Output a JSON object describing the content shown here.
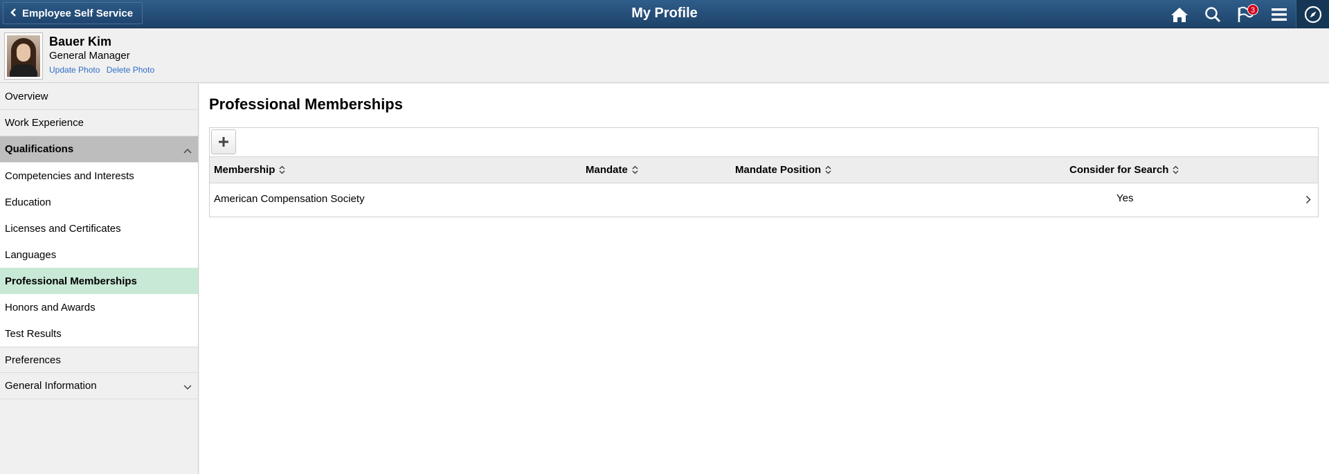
{
  "banner": {
    "back_label": "Employee Self Service",
    "title": "My Profile",
    "notification_count": "3",
    "icons": [
      "home-icon",
      "search-icon",
      "notification-flag-icon",
      "menu-icon",
      "navbar-compass-icon"
    ]
  },
  "profile": {
    "name": "Bauer Kim",
    "job_title": "General Manager",
    "update_photo": "Update Photo",
    "delete_photo": "Delete Photo"
  },
  "sidebar": {
    "items": [
      {
        "label": "Overview"
      },
      {
        "label": "Work Experience"
      },
      {
        "label": "Qualifications"
      },
      {
        "label": "Competencies and Interests"
      },
      {
        "label": "Education"
      },
      {
        "label": "Licenses and Certificates"
      },
      {
        "label": "Languages"
      },
      {
        "label": "Professional Memberships"
      },
      {
        "label": "Honors and Awards"
      },
      {
        "label": "Test Results"
      },
      {
        "label": "Preferences"
      },
      {
        "label": "General Information"
      }
    ],
    "active": "Professional Memberships"
  },
  "main": {
    "section_title": "Professional Memberships",
    "columns": [
      "Membership",
      "Mandate",
      "Mandate Position",
      "Consider for Search"
    ],
    "rows": [
      {
        "membership": "American Compensation Society",
        "mandate": "",
        "mandate_position": "",
        "consider_for_search": "Yes"
      }
    ]
  },
  "colors": {
    "banner": "#1d4268",
    "active_item": "#c8e9d6",
    "group_header": "#bdbdbd",
    "link": "#2e6dc6",
    "badge": "#d0021b"
  }
}
